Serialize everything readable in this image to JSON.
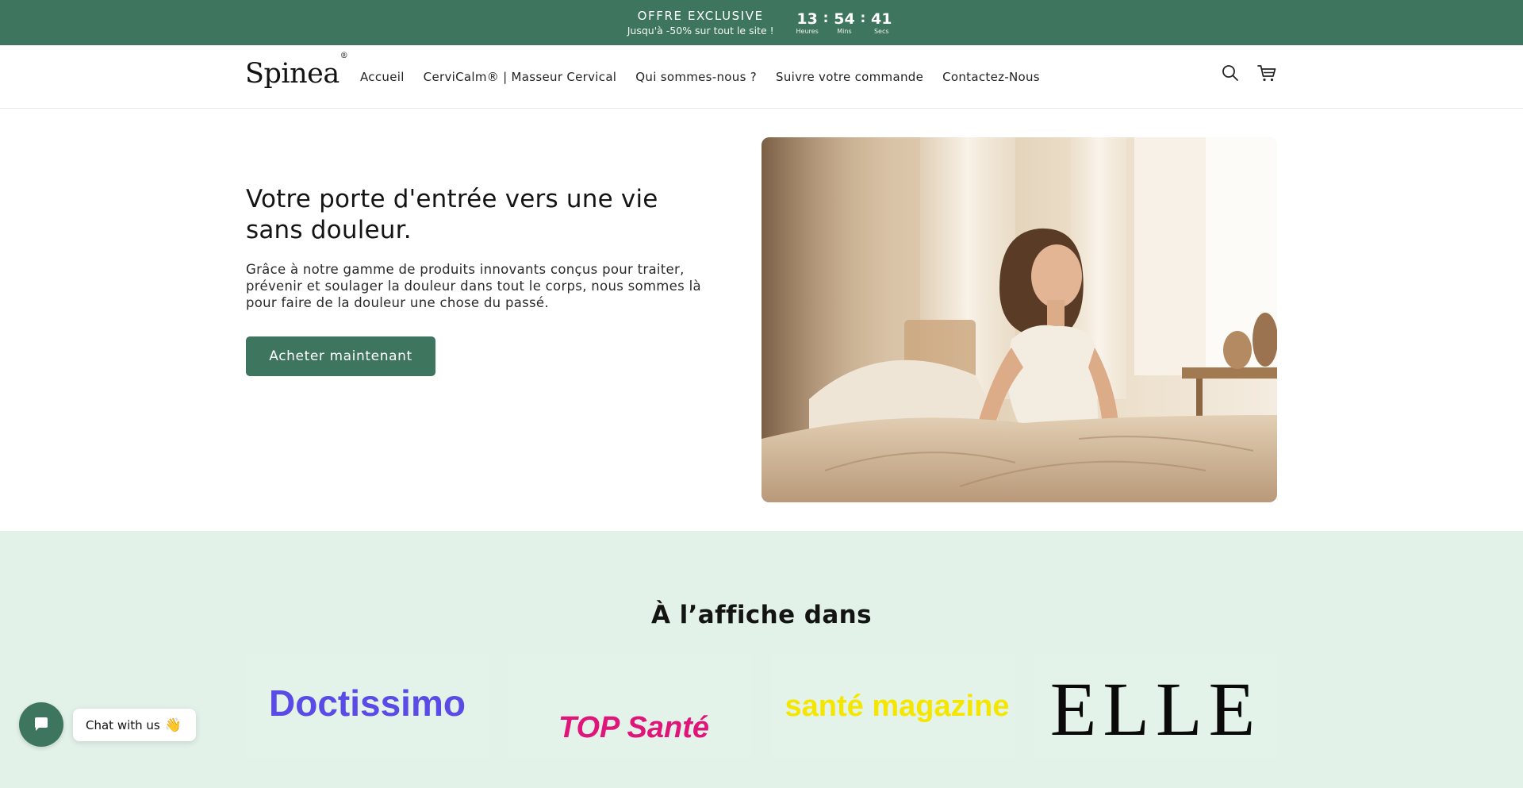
{
  "announcement": {
    "title": "OFFRE EXCLUSIVE",
    "subtitle": "Jusqu'à -50% sur tout le site !",
    "countdown": {
      "hours": "13",
      "hours_label": "Heures",
      "mins": "54",
      "mins_label": "Mins",
      "secs": "41",
      "secs_label": "Secs",
      "separator": ":"
    }
  },
  "header": {
    "logo": "Spinea",
    "logo_mark": "®",
    "nav": [
      {
        "label": "Accueil"
      },
      {
        "label": "CerviCalm® | Masseur Cervical"
      },
      {
        "label": "Qui sommes-nous ?"
      },
      {
        "label": "Suivre votre commande"
      },
      {
        "label": "Contactez-Nous"
      }
    ],
    "icons": [
      "search-icon",
      "cart-icon"
    ]
  },
  "hero": {
    "title": "Votre porte d'entrée vers une vie sans douleur.",
    "text": "Grâce à notre gamme de produits innovants conçus pour traiter, prévenir et soulager la douleur dans tout le corps, nous sommes là pour faire de la douleur une chose du passé.",
    "button": "Acheter maintenant"
  },
  "press": {
    "title": "À l’affiche dans",
    "logos": [
      "Doctissimo",
      "TOP Santé",
      "santé magazine",
      "ELLE"
    ]
  },
  "chat": {
    "label": "Chat with us",
    "emoji": "👋"
  },
  "colors": {
    "accent": "#3e755e",
    "press_bg": "#e2f2e8",
    "doctissimo": "#5a4be6",
    "top_sante": "#e0157a",
    "sante_mag": "#f5e600"
  }
}
